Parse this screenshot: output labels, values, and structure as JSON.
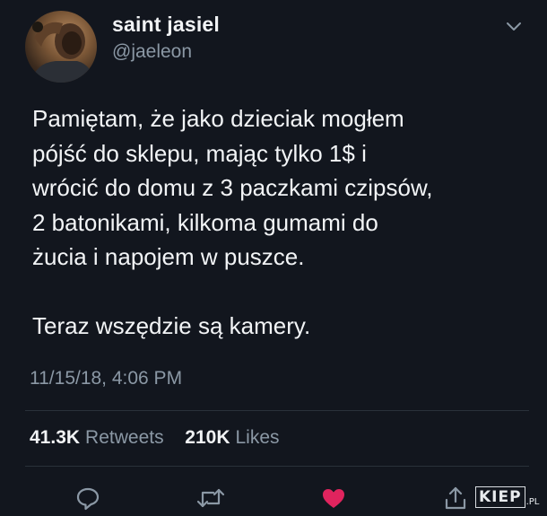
{
  "tweet": {
    "display_name": "saint jasiel",
    "handle": "@jaeleon",
    "body_lines": [
      "Pamiętam, że jako dzieciak mogłem",
      "pójść do sklepu, mając tylko 1$ i",
      "wrócić do domu z 3 paczkami czipsów,",
      "2 batonikami, kilkoma gumami do",
      "żucia i napojem w puszce.",
      "",
      "Teraz wszędzie są kamery."
    ],
    "timestamp": "11/15/18, 4:06 PM",
    "stats": {
      "retweets_count": "41.3K",
      "retweets_label": "Retweets",
      "likes_count": "210K",
      "likes_label": "Likes"
    },
    "liked": true
  },
  "icons": {
    "menu": "chevron-down-icon",
    "reply": "reply-icon",
    "retweet": "retweet-icon",
    "like": "heart-icon",
    "share": "share-icon"
  },
  "colors": {
    "background": "#12161e",
    "text": "#f2f4f6",
    "muted": "#8b98a5",
    "like": "#e0245e"
  },
  "watermark": {
    "main": "KIEP",
    "suffix": ".PL"
  }
}
